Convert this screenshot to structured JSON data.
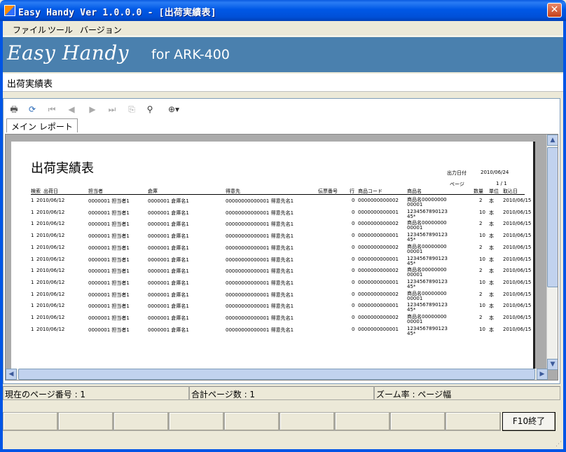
{
  "window": {
    "title": "Easy Handy  Ver 1.0.0.0 - [出荷実績表]",
    "close_label": "✕"
  },
  "menu": [
    {
      "label": "ファイル"
    },
    {
      "label": "ツール"
    },
    {
      "label": "バージョン"
    }
  ],
  "banner": {
    "brand": "Easy Handy",
    "subtitle": "for ARK-400",
    "bg_color": "#4a80ae"
  },
  "page_heading": "出荷実績表",
  "viewer": {
    "toolbar_icons": [
      "print-icon",
      "refresh-icon",
      "first-page-icon",
      "prev-page-icon",
      "next-page-icon",
      "last-page-icon",
      "export-icon",
      "find-icon",
      "zoom-icon"
    ],
    "tab_label": "メイン レポート",
    "report": {
      "title": "出荷実績表",
      "output_date_label": "出力日付",
      "output_date": "2010/06/24",
      "page_label": "ページ",
      "page_value": "1 /  1",
      "headers": [
        "検索",
        "出荷日",
        "担当者",
        "倉庫",
        "得意先",
        "伝票番号",
        "行",
        "商品コード",
        "商品名",
        "数量",
        "単位",
        "取込日"
      ],
      "rows": [
        {
          "no": "1",
          "date": "2010/06/12",
          "staff": "0000001 担当者1",
          "warehouse": "0000001 倉庫名1",
          "customer": "00000000000001 得意先名1",
          "slip": "",
          "line": "0",
          "code": "0000000000002",
          "name": "商品名00000000\n00001",
          "qty": "2",
          "unit": "本",
          "import": "2010/06/15"
        },
        {
          "no": "1",
          "date": "2010/06/12",
          "staff": "0000001 担当者1",
          "warehouse": "0000001 倉庫名1",
          "customer": "00000000000001 得意先名1",
          "slip": "",
          "line": "0",
          "code": "0000000000001",
          "name": "1234567890123\n45*",
          "qty": "10",
          "unit": "本",
          "import": "2010/06/15"
        },
        {
          "no": "1",
          "date": "2010/06/12",
          "staff": "0000001 担当者1",
          "warehouse": "0000001 倉庫名1",
          "customer": "00000000000001 得意先名1",
          "slip": "",
          "line": "0",
          "code": "0000000000002",
          "name": "商品名00000000\n00001",
          "qty": "2",
          "unit": "本",
          "import": "2010/06/15"
        },
        {
          "no": "1",
          "date": "2010/06/12",
          "staff": "0000001 担当者1",
          "warehouse": "0000001 倉庫名1",
          "customer": "00000000000001 得意先名1",
          "slip": "",
          "line": "0",
          "code": "0000000000001",
          "name": "1234567890123\n45*",
          "qty": "10",
          "unit": "本",
          "import": "2010/06/15"
        },
        {
          "no": "1",
          "date": "2010/06/12",
          "staff": "0000001 担当者1",
          "warehouse": "0000001 倉庫名1",
          "customer": "00000000000001 得意先名1",
          "slip": "",
          "line": "0",
          "code": "0000000000002",
          "name": "商品名00000000\n00001",
          "qty": "2",
          "unit": "本",
          "import": "2010/06/15"
        },
        {
          "no": "1",
          "date": "2010/06/12",
          "staff": "0000001 担当者1",
          "warehouse": "0000001 倉庫名1",
          "customer": "00000000000001 得意先名1",
          "slip": "",
          "line": "0",
          "code": "0000000000001",
          "name": "1234567890123\n45*",
          "qty": "10",
          "unit": "本",
          "import": "2010/06/15"
        },
        {
          "no": "1",
          "date": "2010/06/12",
          "staff": "0000001 担当者1",
          "warehouse": "0000001 倉庫名1",
          "customer": "00000000000001 得意先名1",
          "slip": "",
          "line": "0",
          "code": "0000000000002",
          "name": "商品名00000000\n00001",
          "qty": "2",
          "unit": "本",
          "import": "2010/06/15"
        },
        {
          "no": "1",
          "date": "2010/06/12",
          "staff": "0000001 担当者1",
          "warehouse": "0000001 倉庫名1",
          "customer": "00000000000001 得意先名1",
          "slip": "",
          "line": "0",
          "code": "0000000000001",
          "name": "1234567890123\n45*",
          "qty": "10",
          "unit": "本",
          "import": "2010/06/15"
        },
        {
          "no": "1",
          "date": "2010/06/12",
          "staff": "0000001 担当者1",
          "warehouse": "0000001 倉庫名1",
          "customer": "00000000000001 得意先名1",
          "slip": "",
          "line": "0",
          "code": "0000000000002",
          "name": "商品名00000000\n00001",
          "qty": "2",
          "unit": "本",
          "import": "2010/06/15"
        },
        {
          "no": "1",
          "date": "2010/06/12",
          "staff": "0000001 担当者1",
          "warehouse": "0000001 倉庫名1",
          "customer": "00000000000001 得意先名1",
          "slip": "",
          "line": "0",
          "code": "0000000000001",
          "name": "1234567890123\n45*",
          "qty": "10",
          "unit": "本",
          "import": "2010/06/15"
        },
        {
          "no": "1",
          "date": "2010/06/12",
          "staff": "0000001 担当者1",
          "warehouse": "0000001 倉庫名1",
          "customer": "00000000000001 得意先名1",
          "slip": "",
          "line": "0",
          "code": "0000000000002",
          "name": "商品名00000000\n00001",
          "qty": "2",
          "unit": "本",
          "import": "2010/06/15"
        },
        {
          "no": "1",
          "date": "2010/06/12",
          "staff": "0000001 担当者1",
          "warehouse": "0000001 倉庫名1",
          "customer": "00000000000001 得意先名1",
          "slip": "",
          "line": "0",
          "code": "0000000000001",
          "name": "1234567890123\n45*",
          "qty": "10",
          "unit": "本",
          "import": "2010/06/15"
        }
      ]
    }
  },
  "status": {
    "current_page": "現在のページ番号 : 1",
    "total_pages": "合計ページ数 : 1",
    "zoom": "ズーム率 : ページ幅"
  },
  "function_keys": [
    {
      "label": ""
    },
    {
      "label": ""
    },
    {
      "label": ""
    },
    {
      "label": ""
    },
    {
      "label": ""
    },
    {
      "label": ""
    },
    {
      "label": ""
    },
    {
      "label": ""
    },
    {
      "label": ""
    },
    {
      "label": "F10終了"
    }
  ]
}
